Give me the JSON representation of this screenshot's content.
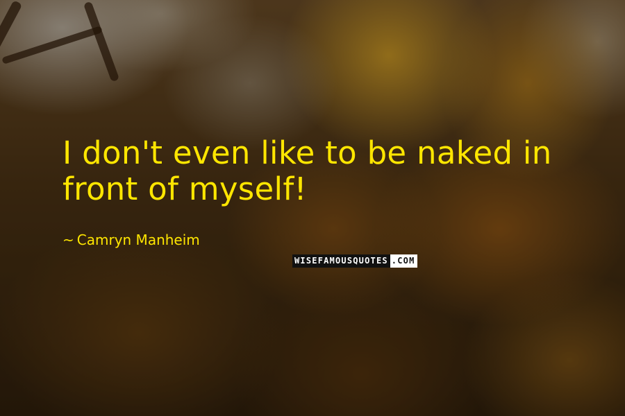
{
  "quote": {
    "text": "I don't even like to be naked in front of myself!",
    "author": "Camryn Manheim",
    "author_prefix": "~"
  },
  "watermark": {
    "main": "WISEFAMOUSQUOTES",
    "suffix": ".COM"
  },
  "colors": {
    "text": "#ffe600",
    "background": "#4a3315"
  }
}
